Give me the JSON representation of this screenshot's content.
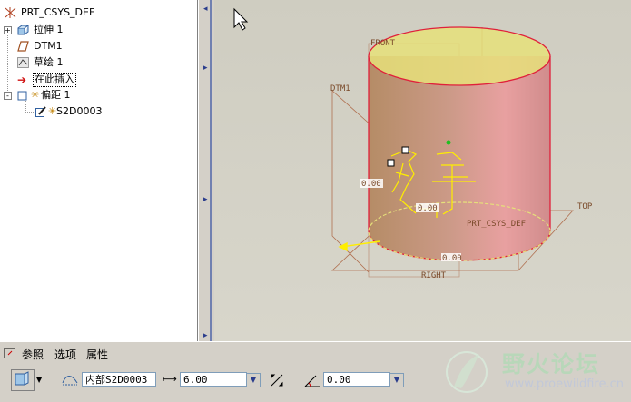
{
  "tree": {
    "items": [
      {
        "label": "PRT_CSYS_DEF",
        "icon": "csys-icon"
      },
      {
        "label": "拉伸 1",
        "icon": "extrude-icon",
        "expander": "+"
      },
      {
        "label": "DTM1",
        "icon": "datum-plane-icon"
      },
      {
        "label": "草绘 1",
        "icon": "sketch-icon"
      },
      {
        "label": "在此插入",
        "icon": "insert-here-arrow-icon"
      },
      {
        "label": "偏距 1",
        "icon": "offset-feature-icon",
        "expander": "-"
      },
      {
        "label": "S2D0003",
        "icon": "sketch-child-icon"
      }
    ]
  },
  "viewport": {
    "labels": {
      "front": "FRONT",
      "dtm1": "DTM1",
      "top": "TOP",
      "right": "RIGHT",
      "csys": "PRT_CSYS_DEF",
      "dim1": "0.00",
      "dim2": "0.00",
      "dim3": "0.00"
    },
    "colors": {
      "cylinder_fill": "#c9928a",
      "cylinder_edge": "#e0203a",
      "top_ellipse": "#e6e07a",
      "datum": "#b07050",
      "sketch": "#ffee00"
    }
  },
  "dashboard": {
    "tabs": [
      "参照",
      "选项",
      "属性"
    ],
    "sketch_field": "内部S2D0003",
    "offset_value": "6.00",
    "angle_value": "0.00"
  },
  "watermark": {
    "text": "野火论坛",
    "url": "www.proewildfire.cn"
  }
}
